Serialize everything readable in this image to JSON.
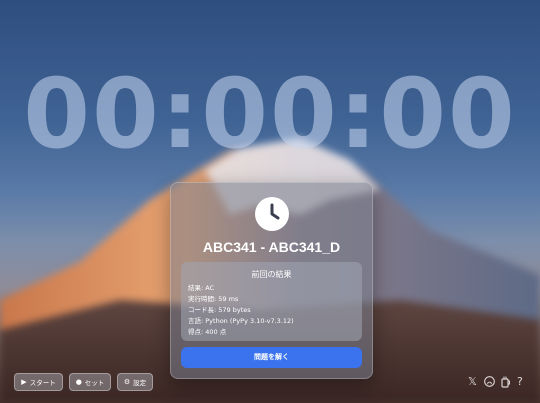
{
  "timer": {
    "display": "00:00:00"
  },
  "card": {
    "contest_title": "ABC341 - ABC341_D",
    "result": {
      "title": "前回の結果",
      "result_line": "結果: AC",
      "time_line": "実行時間: 59 ms",
      "code_line": "コード長: 579 bytes",
      "language_line": "言語: Python (PyPy 3.10-v7.3.12)",
      "score_line": "得点: 400 点"
    },
    "solve_button": "問題を解く"
  },
  "bottom_bar": {
    "start": "スタート",
    "set": "セット",
    "settings": "設定"
  },
  "social": {
    "x_icon": "𝕏",
    "github_icon": "github-icon",
    "coffee_icon": "coffee-icon",
    "help_icon": "?"
  },
  "colors": {
    "accent": "#3b72ee"
  }
}
